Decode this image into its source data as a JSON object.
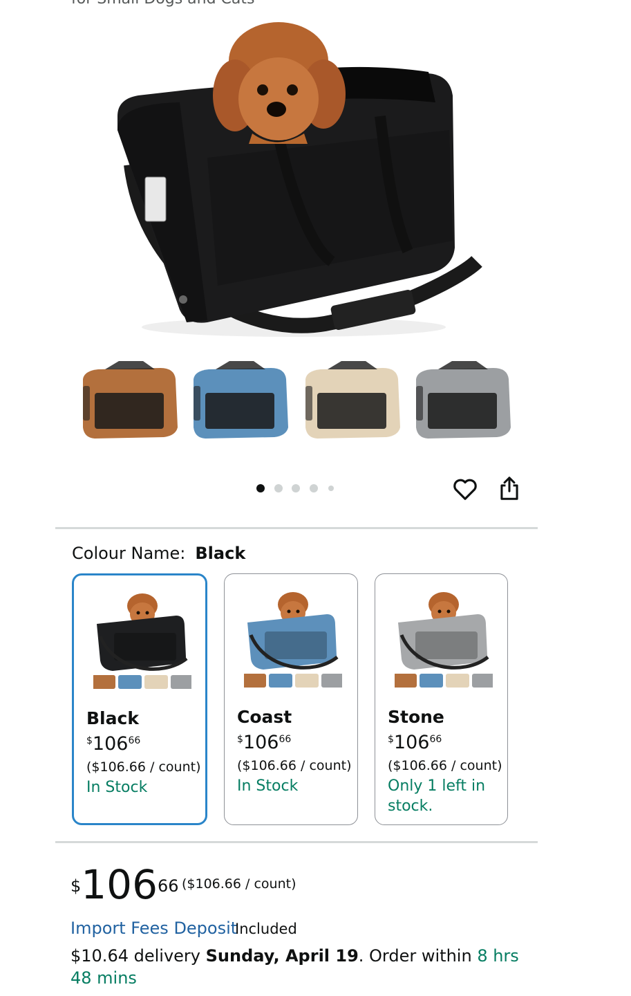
{
  "header": {
    "subtitle_fragment": "for Small Dogs and Cats"
  },
  "product": {
    "hero_alt": "Black pet carrier bag with poodle"
  },
  "thumbnails": [
    {
      "label": "brown-carrier",
      "color": "#b3703d"
    },
    {
      "label": "blue-carrier",
      "color": "#5c90bb"
    },
    {
      "label": "beige-carrier",
      "color": "#e3d3b8"
    },
    {
      "label": "grey-carrier",
      "color": "#9c9fa2"
    }
  ],
  "carousel": {
    "total": 5,
    "active": 1
  },
  "actions": {
    "favorite_icon": "heart-outline-icon",
    "share_icon": "share-icon"
  },
  "colour": {
    "label": "Colour Name:",
    "value": "Black"
  },
  "variants": [
    {
      "name": "Black",
      "currency": "$",
      "whole": "106",
      "fraction": "66",
      "unit_price": "($106.66 / count)",
      "stock": "In Stock",
      "selected": true,
      "bag_color": "#1e1f21"
    },
    {
      "name": "Coast",
      "currency": "$",
      "whole": "106",
      "fraction": "66",
      "unit_price": "($106.66 / count)",
      "stock": "In Stock",
      "selected": false,
      "bag_color": "#5d90bb"
    },
    {
      "name": "Stone",
      "currency": "$",
      "whole": "106",
      "fraction": "66",
      "unit_price": "($106.66 / count)",
      "stock": "Only 1 left in stock.",
      "selected": false,
      "bag_color": "#a6a8aa"
    }
  ],
  "price": {
    "currency": "$",
    "whole": "106",
    "fraction": "66",
    "unit_price": "($106.66 / count)"
  },
  "import_fees": {
    "link": "Import Fees Deposit",
    "status": "Included"
  },
  "delivery": {
    "cost": "$10.64 delivery",
    "date": "Sunday, April 19",
    "order_within": ". Order within",
    "countdown": "8 hrs 48 mins"
  },
  "colors": {
    "link": "#2162a1",
    "instock": "#067d62",
    "selected_border": "#2a85c9"
  }
}
